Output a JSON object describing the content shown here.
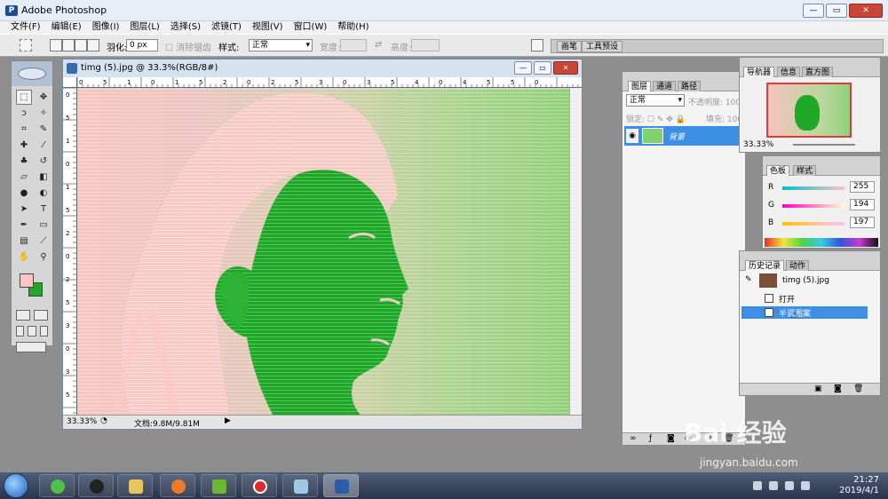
{
  "app": {
    "title": "Adobe Photoshop",
    "icon": "photoshop-icon"
  },
  "menu": [
    "文件(F)",
    "编辑(E)",
    "图像(I)",
    "图层(L)",
    "选择(S)",
    "滤镜(T)",
    "视图(V)",
    "窗口(W)",
    "帮助(H)"
  ],
  "options": {
    "feather_label": "羽化:",
    "feather_value": "0 px",
    "antialias_label": "消除锯齿",
    "style_label": "样式:",
    "style_value": "正常",
    "width_label": "宽度:",
    "height_label": "高度:",
    "palette_tabs": [
      "画笔",
      "工具预设"
    ]
  },
  "document": {
    "title": "timg (5).jpg @ 33.3%(RGB/8#)",
    "zoom": "33.33%",
    "doc_size": "文档:9.8M/9.81M",
    "ruler_ticks": [
      "0",
      "5",
      "1",
      "0",
      "1",
      "5",
      "2",
      "0",
      "2",
      "5",
      "3",
      "0",
      "3",
      "5",
      "4",
      "0",
      "4",
      "5",
      "5",
      "0"
    ],
    "ruler_left_ticks": [
      "0",
      "5",
      "1",
      "0",
      "1",
      "5",
      "2",
      "0",
      "2",
      "5",
      "3",
      "0",
      "3",
      "5"
    ]
  },
  "layers_panel": {
    "tabs": [
      "图层",
      "通道",
      "路径"
    ],
    "blend_mode": "正常",
    "opacity_label": "不透明度:",
    "opacity_value": "100",
    "lock_label": "锁定:",
    "fill_label": "填充:",
    "fill_value": "100",
    "layer_name": "背景"
  },
  "navigator": {
    "tabs": [
      "导航器",
      "信息",
      "直方图"
    ],
    "zoom": "33.33%"
  },
  "color_panel": {
    "tabs": [
      "色板",
      "样式"
    ],
    "channels": [
      {
        "name": "R",
        "value": "255",
        "gradient": "linear-gradient(90deg,#00c2c5,#ffc2c5)"
      },
      {
        "name": "G",
        "value": "194",
        "gradient": "linear-gradient(90deg,#ff00c5,#ffffc5)"
      },
      {
        "name": "B",
        "value": "197",
        "gradient": "linear-gradient(90deg,#ffc200,#ffc2ff)"
      }
    ]
  },
  "history": {
    "tabs": [
      "历史记录",
      "动作"
    ],
    "snapshot": "timg (5).jpg",
    "items": [
      {
        "label": "打开",
        "selected": false
      },
      {
        "label": "半调图案",
        "selected": true
      }
    ]
  },
  "colors": {
    "foreground": "#ffc2c5",
    "background": "#1ea826",
    "selection": "#3c8fe4"
  },
  "tray": {
    "time": "21:27",
    "date": "2019/4/1"
  },
  "watermark": {
    "text": "Bai 经验",
    "url": "jingyan.baidu.com"
  }
}
